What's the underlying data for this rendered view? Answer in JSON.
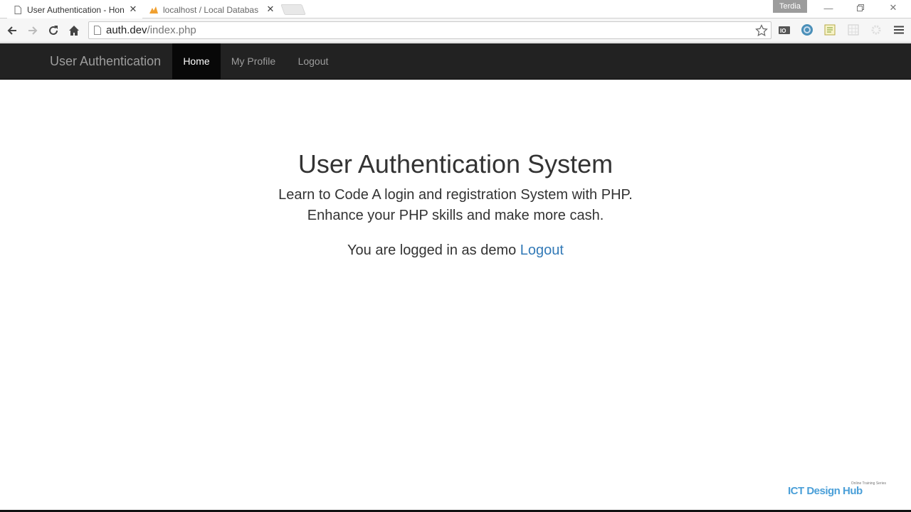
{
  "browser": {
    "tabs": [
      {
        "title": "User Authentication - Hon",
        "active": true
      },
      {
        "title": "localhost / Local Databas",
        "active": false
      }
    ],
    "profile_name": "Terdia",
    "url_host": "auth.dev",
    "url_path": "/index.php"
  },
  "navbar": {
    "brand": "User Authentication",
    "items": [
      {
        "label": "Home",
        "active": true
      },
      {
        "label": "My Profile",
        "active": false
      },
      {
        "label": "Logout",
        "active": false
      }
    ]
  },
  "main": {
    "title": "User Authentication System",
    "subtitle_line1": "Learn to Code A login and registration System with PHP.",
    "subtitle_line2": "Enhance your PHP skills and make more cash.",
    "status_text": "You are logged in as demo",
    "logout_link": "Logout"
  },
  "watermark": {
    "tagline": "Online Training Series",
    "name": "ICT Design Hub"
  },
  "colors": {
    "navbar_bg": "#222222",
    "navbar_active": "#080808",
    "link": "#337ab7"
  }
}
